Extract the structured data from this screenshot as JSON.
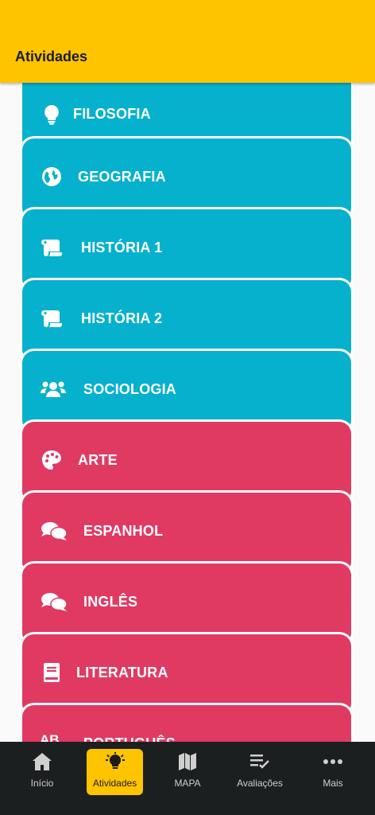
{
  "header": {
    "title": "Atividades"
  },
  "colors": {
    "header": "#FFC400",
    "humanas": "#06B1CE",
    "linguagens": "#E03A63",
    "nav_bg": "#1c1f1f"
  },
  "subjects": [
    {
      "label": "FILOSOFIA",
      "icon": "lightbulb-icon"
    },
    {
      "label": "GEOGRAFIA",
      "icon": "globe-icon"
    },
    {
      "label": "HISTÓRIA 1",
      "icon": "scroll-icon"
    },
    {
      "label": "HISTÓRIA 2",
      "icon": "scroll-icon"
    },
    {
      "label": "SOCIOLOGIA",
      "icon": "users-icon"
    },
    {
      "label": "ARTE",
      "icon": "palette-icon"
    },
    {
      "label": "ESPANHOL",
      "icon": "comments-icon"
    },
    {
      "label": "INGLÊS",
      "icon": "comments-icon"
    },
    {
      "label": "LITERATURA",
      "icon": "book-icon"
    },
    {
      "label": "PORTUGUÊS",
      "icon": "ab-icon",
      "icon_text": "AB"
    }
  ],
  "nav": [
    {
      "label": "Início",
      "icon": "home-icon"
    },
    {
      "label": "Atividades",
      "icon": "lightbulb-icon",
      "active": true
    },
    {
      "label": "MAPA",
      "icon": "map-icon"
    },
    {
      "label": "Avaliações",
      "icon": "checklist-icon"
    },
    {
      "label": "Mais",
      "icon": "more-icon"
    }
  ]
}
